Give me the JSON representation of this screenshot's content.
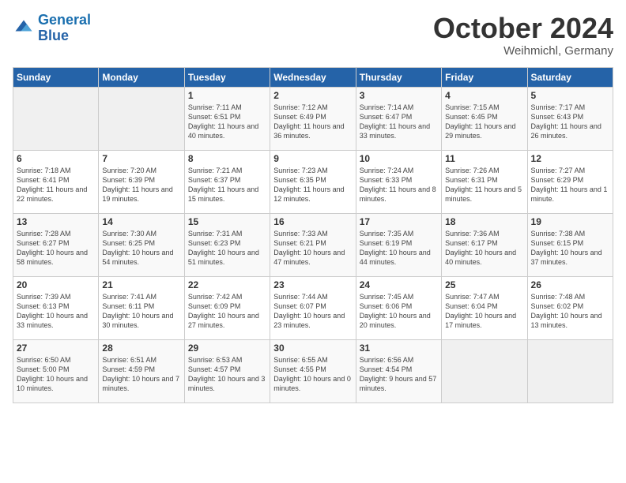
{
  "header": {
    "logo_line1": "General",
    "logo_line2": "Blue",
    "month": "October 2024",
    "location": "Weihmichl, Germany"
  },
  "weekdays": [
    "Sunday",
    "Monday",
    "Tuesday",
    "Wednesday",
    "Thursday",
    "Friday",
    "Saturday"
  ],
  "weeks": [
    [
      {
        "day": "",
        "empty": true
      },
      {
        "day": "",
        "empty": true
      },
      {
        "day": "1",
        "sunrise": "Sunrise: 7:11 AM",
        "sunset": "Sunset: 6:51 PM",
        "daylight": "Daylight: 11 hours and 40 minutes."
      },
      {
        "day": "2",
        "sunrise": "Sunrise: 7:12 AM",
        "sunset": "Sunset: 6:49 PM",
        "daylight": "Daylight: 11 hours and 36 minutes."
      },
      {
        "day": "3",
        "sunrise": "Sunrise: 7:14 AM",
        "sunset": "Sunset: 6:47 PM",
        "daylight": "Daylight: 11 hours and 33 minutes."
      },
      {
        "day": "4",
        "sunrise": "Sunrise: 7:15 AM",
        "sunset": "Sunset: 6:45 PM",
        "daylight": "Daylight: 11 hours and 29 minutes."
      },
      {
        "day": "5",
        "sunrise": "Sunrise: 7:17 AM",
        "sunset": "Sunset: 6:43 PM",
        "daylight": "Daylight: 11 hours and 26 minutes."
      }
    ],
    [
      {
        "day": "6",
        "sunrise": "Sunrise: 7:18 AM",
        "sunset": "Sunset: 6:41 PM",
        "daylight": "Daylight: 11 hours and 22 minutes."
      },
      {
        "day": "7",
        "sunrise": "Sunrise: 7:20 AM",
        "sunset": "Sunset: 6:39 PM",
        "daylight": "Daylight: 11 hours and 19 minutes."
      },
      {
        "day": "8",
        "sunrise": "Sunrise: 7:21 AM",
        "sunset": "Sunset: 6:37 PM",
        "daylight": "Daylight: 11 hours and 15 minutes."
      },
      {
        "day": "9",
        "sunrise": "Sunrise: 7:23 AM",
        "sunset": "Sunset: 6:35 PM",
        "daylight": "Daylight: 11 hours and 12 minutes."
      },
      {
        "day": "10",
        "sunrise": "Sunrise: 7:24 AM",
        "sunset": "Sunset: 6:33 PM",
        "daylight": "Daylight: 11 hours and 8 minutes."
      },
      {
        "day": "11",
        "sunrise": "Sunrise: 7:26 AM",
        "sunset": "Sunset: 6:31 PM",
        "daylight": "Daylight: 11 hours and 5 minutes."
      },
      {
        "day": "12",
        "sunrise": "Sunrise: 7:27 AM",
        "sunset": "Sunset: 6:29 PM",
        "daylight": "Daylight: 11 hours and 1 minute."
      }
    ],
    [
      {
        "day": "13",
        "sunrise": "Sunrise: 7:28 AM",
        "sunset": "Sunset: 6:27 PM",
        "daylight": "Daylight: 10 hours and 58 minutes."
      },
      {
        "day": "14",
        "sunrise": "Sunrise: 7:30 AM",
        "sunset": "Sunset: 6:25 PM",
        "daylight": "Daylight: 10 hours and 54 minutes."
      },
      {
        "day": "15",
        "sunrise": "Sunrise: 7:31 AM",
        "sunset": "Sunset: 6:23 PM",
        "daylight": "Daylight: 10 hours and 51 minutes."
      },
      {
        "day": "16",
        "sunrise": "Sunrise: 7:33 AM",
        "sunset": "Sunset: 6:21 PM",
        "daylight": "Daylight: 10 hours and 47 minutes."
      },
      {
        "day": "17",
        "sunrise": "Sunrise: 7:35 AM",
        "sunset": "Sunset: 6:19 PM",
        "daylight": "Daylight: 10 hours and 44 minutes."
      },
      {
        "day": "18",
        "sunrise": "Sunrise: 7:36 AM",
        "sunset": "Sunset: 6:17 PM",
        "daylight": "Daylight: 10 hours and 40 minutes."
      },
      {
        "day": "19",
        "sunrise": "Sunrise: 7:38 AM",
        "sunset": "Sunset: 6:15 PM",
        "daylight": "Daylight: 10 hours and 37 minutes."
      }
    ],
    [
      {
        "day": "20",
        "sunrise": "Sunrise: 7:39 AM",
        "sunset": "Sunset: 6:13 PM",
        "daylight": "Daylight: 10 hours and 33 minutes."
      },
      {
        "day": "21",
        "sunrise": "Sunrise: 7:41 AM",
        "sunset": "Sunset: 6:11 PM",
        "daylight": "Daylight: 10 hours and 30 minutes."
      },
      {
        "day": "22",
        "sunrise": "Sunrise: 7:42 AM",
        "sunset": "Sunset: 6:09 PM",
        "daylight": "Daylight: 10 hours and 27 minutes."
      },
      {
        "day": "23",
        "sunrise": "Sunrise: 7:44 AM",
        "sunset": "Sunset: 6:07 PM",
        "daylight": "Daylight: 10 hours and 23 minutes."
      },
      {
        "day": "24",
        "sunrise": "Sunrise: 7:45 AM",
        "sunset": "Sunset: 6:06 PM",
        "daylight": "Daylight: 10 hours and 20 minutes."
      },
      {
        "day": "25",
        "sunrise": "Sunrise: 7:47 AM",
        "sunset": "Sunset: 6:04 PM",
        "daylight": "Daylight: 10 hours and 17 minutes."
      },
      {
        "day": "26",
        "sunrise": "Sunrise: 7:48 AM",
        "sunset": "Sunset: 6:02 PM",
        "daylight": "Daylight: 10 hours and 13 minutes."
      }
    ],
    [
      {
        "day": "27",
        "sunrise": "Sunrise: 6:50 AM",
        "sunset": "Sunset: 5:00 PM",
        "daylight": "Daylight: 10 hours and 10 minutes."
      },
      {
        "day": "28",
        "sunrise": "Sunrise: 6:51 AM",
        "sunset": "Sunset: 4:59 PM",
        "daylight": "Daylight: 10 hours and 7 minutes."
      },
      {
        "day": "29",
        "sunrise": "Sunrise: 6:53 AM",
        "sunset": "Sunset: 4:57 PM",
        "daylight": "Daylight: 10 hours and 3 minutes."
      },
      {
        "day": "30",
        "sunrise": "Sunrise: 6:55 AM",
        "sunset": "Sunset: 4:55 PM",
        "daylight": "Daylight: 10 hours and 0 minutes."
      },
      {
        "day": "31",
        "sunrise": "Sunrise: 6:56 AM",
        "sunset": "Sunset: 4:54 PM",
        "daylight": "Daylight: 9 hours and 57 minutes."
      },
      {
        "day": "",
        "empty": true
      },
      {
        "day": "",
        "empty": true
      }
    ]
  ]
}
